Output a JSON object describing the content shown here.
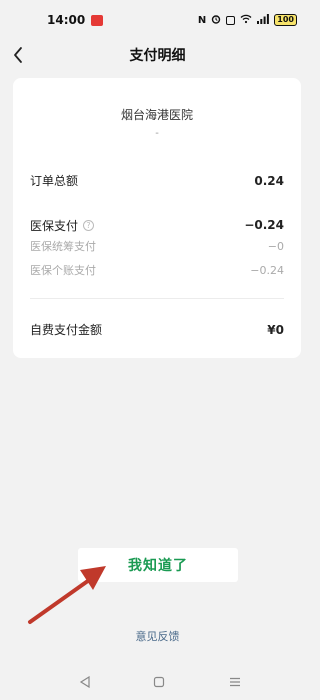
{
  "status_bar": {
    "time": "14:00",
    "battery": "100",
    "icons": [
      "nfc-icon",
      "alarm-icon",
      "hd-icon",
      "wifi-icon",
      "signal-icon",
      "battery-icon"
    ]
  },
  "header": {
    "title": "支付明细",
    "back_icon": "chevron-left-icon"
  },
  "card": {
    "hospital": "烟台海港医院",
    "hospital_sub": "-",
    "order_total_label": "订单总额",
    "order_total_value": "0.24",
    "insurance_label": "医保支付",
    "insurance_value": "−0.24",
    "insurance_pool_label": "医保统筹支付",
    "insurance_pool_value": "−0",
    "insurance_personal_label": "医保个账支付",
    "insurance_personal_value": "−0.24",
    "self_pay_label": "自费支付金额",
    "self_pay_value": "¥0"
  },
  "actions": {
    "ok_label": "我知道了",
    "feedback_label": "意见反馈"
  },
  "colors": {
    "accent_green": "#1a9a52",
    "annotation_arrow": "#c0392b"
  }
}
